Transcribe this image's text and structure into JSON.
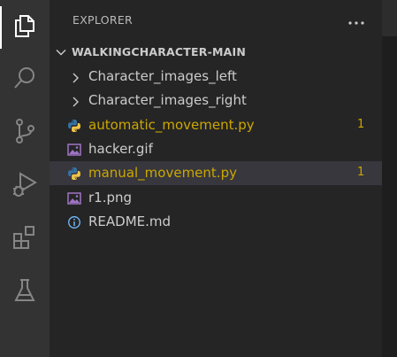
{
  "explorer": {
    "title": "EXPLORER",
    "more_actions_icon": "ellipsis-icon",
    "folder": {
      "name": "WALKINGCHARACTER-MAIN",
      "expanded": true
    },
    "items": [
      {
        "type": "folder",
        "label": "Character_images_left",
        "icon": "chevron-right-icon"
      },
      {
        "type": "folder",
        "label": "Character_images_right",
        "icon": "chevron-right-icon"
      },
      {
        "type": "file",
        "label": "automatic_movement.py",
        "icon": "python-icon",
        "badge": "1",
        "modified": true
      },
      {
        "type": "file",
        "label": "hacker.gif",
        "icon": "image-icon"
      },
      {
        "type": "file",
        "label": "manual_movement.py",
        "icon": "python-icon",
        "badge": "1",
        "modified": true,
        "selected": true
      },
      {
        "type": "file",
        "label": "r1.png",
        "icon": "image-icon"
      },
      {
        "type": "file",
        "label": "README.md",
        "icon": "info-icon"
      }
    ]
  },
  "activity_bar": [
    {
      "name": "explorer",
      "icon": "files-icon",
      "active": true
    },
    {
      "name": "search",
      "icon": "search-icon"
    },
    {
      "name": "source-control",
      "icon": "source-control-icon"
    },
    {
      "name": "run-and-debug",
      "icon": "run-debug-icon"
    },
    {
      "name": "extensions",
      "icon": "extensions-icon"
    },
    {
      "name": "testing",
      "icon": "flask-icon"
    }
  ],
  "colors": {
    "activity_bar": "#333333",
    "sidebar": "#252526",
    "selection": "#37373d",
    "modified": "#cca700",
    "python_blue": "#3572a5",
    "python_yellow": "#f0c34a",
    "image_purple": "#a074c4",
    "info_blue": "#75beff"
  }
}
